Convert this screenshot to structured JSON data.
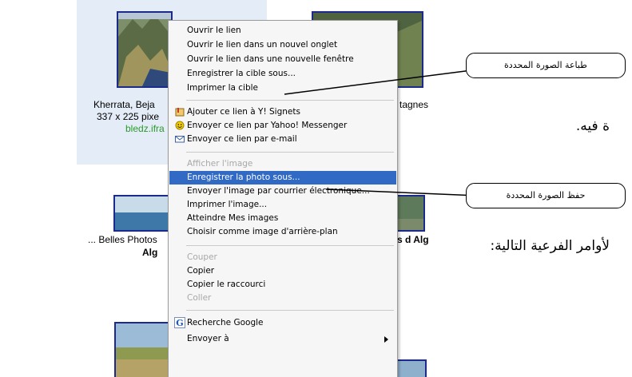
{
  "results": {
    "item1": {
      "title": "Kherrata, Beja",
      "size": "337 x 225 pixe",
      "site": "bledz.ifra"
    },
    "item2": {
      "title": "tagnes"
    },
    "item3": {
      "title": "... Belles Photos",
      "title2": "Alg"
    },
    "item4": {
      "title": "s d Alg"
    }
  },
  "arabic_text": {
    "line1": "ة فيه.",
    "line2": "لأوامر الفرعية التالية:"
  },
  "context_menu": {
    "group1": [
      "Ouvrir le lien",
      "Ouvrir le lien dans un nouvel onglet",
      "Ouvrir le lien dans une nouvelle fenêtre",
      "Enregistrer la cible sous...",
      "Imprimer la cible"
    ],
    "group2": [
      "Ajouter ce lien à Y! Signets",
      "Envoyer ce lien par Yahoo! Messenger",
      "Envoyer ce lien par e-mail"
    ],
    "group3_disabled": "Afficher l'image",
    "group3_highlighted": "Enregistrer la photo sous...",
    "group3": [
      "Envoyer l'image par courrier électronique...",
      "Imprimer l'image...",
      "Atteindre Mes images",
      "Choisir comme image d'arrière-plan"
    ],
    "group4_cut": "Couper",
    "group4_copy": "Copier",
    "group4_copy_shortcut": "Copier le raccourci",
    "group4_paste": "Coller",
    "group5": [
      "Recherche Google",
      "Envoyer à"
    ]
  },
  "callouts": {
    "print": "طباعة الصورة المحددة",
    "save": "حفظ الصورة المحددة"
  },
  "colors": {
    "menu_highlight": "#316ac5",
    "link_green": "#2a9a2a",
    "thumb_border": "#1c2a8c",
    "selection_bg": "#e4ecf7"
  }
}
